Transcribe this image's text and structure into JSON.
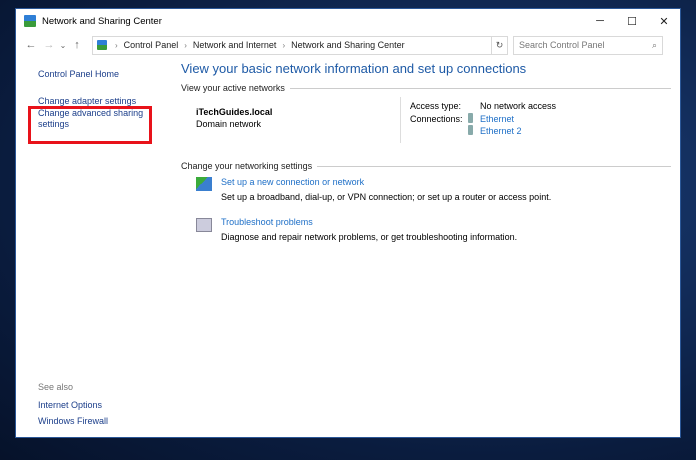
{
  "window": {
    "title": "Network and Sharing Center",
    "controls": {
      "minimize": "─",
      "maximize": "☐",
      "close": "✕"
    }
  },
  "nav": {
    "back": "←",
    "forward": "→",
    "recent": "⌄",
    "up": "↑",
    "breadcrumb": [
      "Control Panel",
      "Network and Internet",
      "Network and Sharing Center"
    ],
    "refresh": "↻",
    "search_placeholder": "Search Control Panel",
    "search_icon": "⌕"
  },
  "sidebar": {
    "items": [
      "Control Panel Home",
      "Change adapter settings",
      "Change advanced sharing settings"
    ],
    "see_also_label": "See also",
    "see_also": [
      "Internet Options",
      "Windows Firewall"
    ]
  },
  "main": {
    "heading": "View your basic network information and set up connections",
    "active_label": "View your active networks",
    "network_name": "iTechGuides.local",
    "network_type": "Domain network",
    "access_type_label": "Access type:",
    "access_type": "No network access",
    "connections_label": "Connections:",
    "connections": [
      "Ethernet",
      "Ethernet 2"
    ],
    "change_label": "Change your networking settings",
    "tasks": [
      {
        "title": "Set up a new connection or network",
        "desc": "Set up a broadband, dial-up, or VPN connection; or set up a router or access point."
      },
      {
        "title": "Troubleshoot problems",
        "desc": "Diagnose and repair network problems, or get troubleshooting information."
      }
    ]
  },
  "colors": {
    "highlight": "#e8121a",
    "link": "#1e6fc7"
  }
}
